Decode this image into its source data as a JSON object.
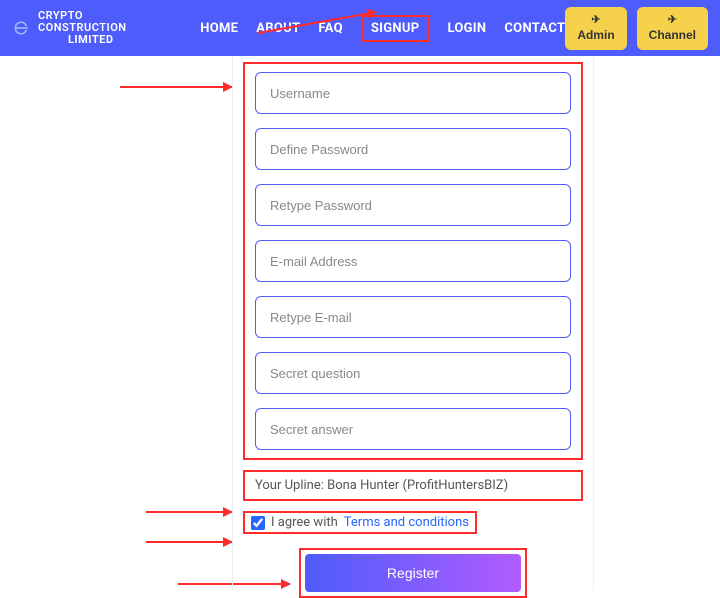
{
  "brand": {
    "line1": "CRYPTO CONSTRUCTION",
    "line2": "LIMITED"
  },
  "nav": {
    "home": "HOME",
    "about": "ABOUT",
    "faq": "FAQ",
    "signup": "SIGNUP",
    "login": "LOGIN",
    "contact": "CONTACT"
  },
  "header_buttons": {
    "admin": "Admin",
    "channel": "Channel"
  },
  "form": {
    "placeholders": {
      "username": "Username",
      "password": "Define Password",
      "password2": "Retype Password",
      "email": "E-mail Address",
      "email2": "Retype E-mail",
      "secret_q": "Secret question",
      "secret_a": "Secret answer"
    },
    "upline": "Your Upline: Bona Hunter (ProfitHuntersBIZ)",
    "terms_prefix": "I agree with ",
    "terms_link": "Terms and conditions",
    "terms_checked": true,
    "register": "Register"
  }
}
